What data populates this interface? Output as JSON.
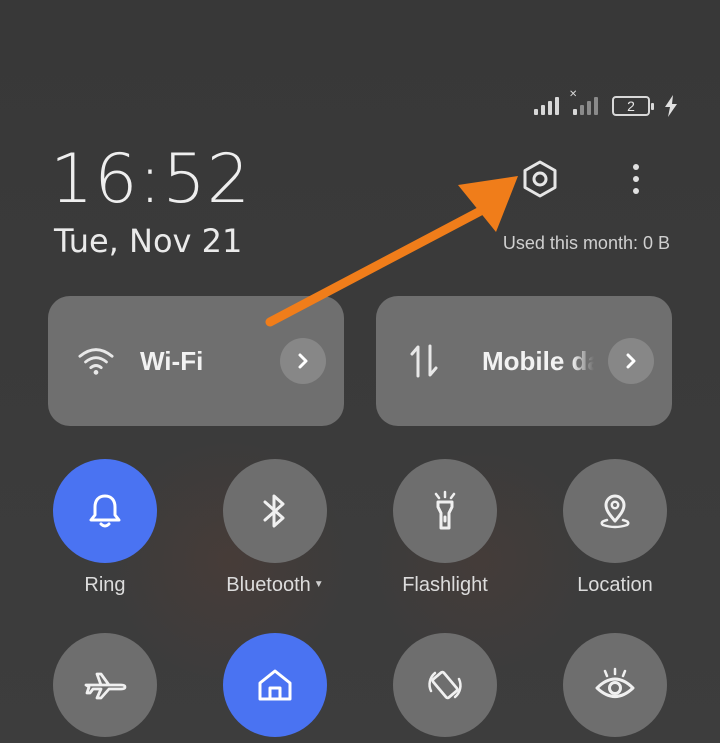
{
  "status_bar": {
    "battery_level": "2",
    "signal_icons": [
      "signal-strength-icon",
      "signal-no-service-icon"
    ],
    "charging_icon": "charging-bolt-icon"
  },
  "header": {
    "time": "16:52",
    "date": "Tue, Nov 21",
    "usage": "Used this month: 0 B"
  },
  "big_tiles": [
    {
      "label": "Wi-Fi",
      "icon": "wifi-icon"
    },
    {
      "label": "Mobile data",
      "icon": "mobile-data-icon"
    }
  ],
  "quick_settings": [
    {
      "label": "Ring",
      "icon": "bell-icon",
      "active": true
    },
    {
      "label": "Bluetooth",
      "icon": "bluetooth-icon",
      "active": false,
      "has_dropdown": true
    },
    {
      "label": "Flashlight",
      "icon": "flashlight-icon",
      "active": false
    },
    {
      "label": "Location",
      "icon": "location-pin-icon",
      "active": false
    },
    {
      "label": "",
      "icon": "airplane-icon",
      "active": false
    },
    {
      "label": "",
      "icon": "home-icon",
      "active": true
    },
    {
      "label": "",
      "icon": "auto-rotate-icon",
      "active": false
    },
    {
      "label": "",
      "icon": "eye-icon",
      "active": false
    }
  ],
  "colors": {
    "accent": "#4a73f2",
    "annotation_arrow": "#f07d1a"
  }
}
